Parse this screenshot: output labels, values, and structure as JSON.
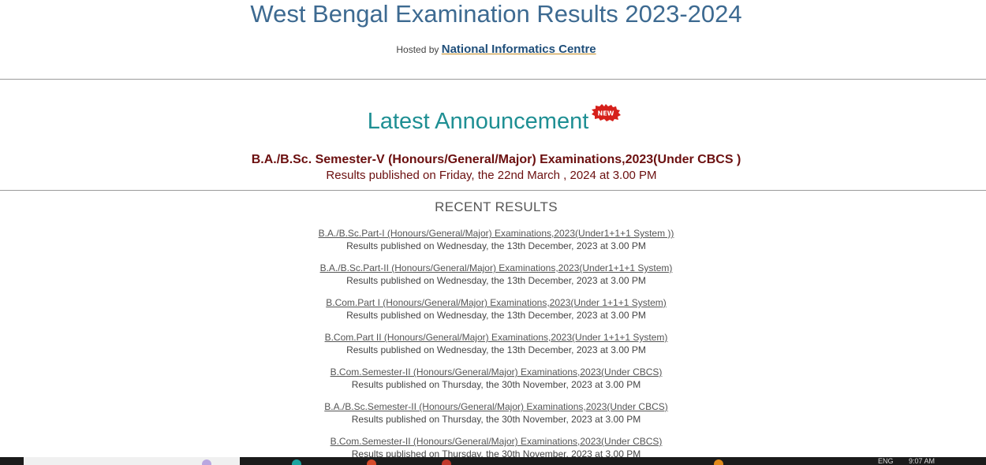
{
  "header": {
    "title": "West Bengal Examination Results 2023-2024",
    "hosted_prefix": "Hosted by",
    "host_name": "National Informatics Centre"
  },
  "announcement": {
    "title": "Latest Announcement",
    "badge": "NEW",
    "exam": "B.A./B.Sc. Semester-V (Honours/General/Major) Examinations,2023(Under CBCS )",
    "published": "Results published on Friday, the 22nd March , 2024 at 3.00 PM"
  },
  "recent": {
    "heading": "RECENT RESULTS",
    "items": [
      {
        "label": "B.A./B.Sc.Part-I (Honours/General/Major) Examinations,2023(Under1+1+1 System ))",
        "published": "Results published on Wednesday, the 13th December, 2023 at 3.00 PM"
      },
      {
        "label": "B.A./B.Sc.Part-II (Honours/General/Major) Examinations,2023(Under1+1+1 System)",
        "published": "Results published on Wednesday, the 13th December, 2023 at 3.00 PM"
      },
      {
        "label": "B.Com.Part I (Honours/General/Major) Examinations,2023(Under 1+1+1 System)",
        "published": "Results published on Wednesday, the 13th December, 2023 at 3.00 PM"
      },
      {
        "label": "B.Com.Part II (Honours/General/Major) Examinations,2023(Under 1+1+1 System)",
        "published": "Results published on Wednesday, the 13th December, 2023 at 3.00 PM"
      },
      {
        "label": "B.Com.Semester-II (Honours/General/Major) Examinations,2023(Under CBCS)",
        "published": "Results published on Thursday, the 30th November, 2023 at 3.00 PM"
      },
      {
        "label": "B.A./B.Sc.Semester-II (Honours/General/Major) Examinations,2023(Under CBCS)",
        "published": "Results published on Thursday, the 30th November, 2023 at 3.00 PM"
      },
      {
        "label": "B.Com.Semester-II (Honours/General/Major) Examinations,2023(Under CBCS)",
        "published": "Results published on Thursday, the 30th November, 2023 at 3.00 PM"
      }
    ]
  },
  "taskbar": {
    "language": "ENG",
    "time": "9:07 AM"
  },
  "colors": {
    "title": "#3d6a91",
    "announce_title": "#1e8f93",
    "announce_text": "#6b0f0f",
    "badge": "#d6201b"
  }
}
